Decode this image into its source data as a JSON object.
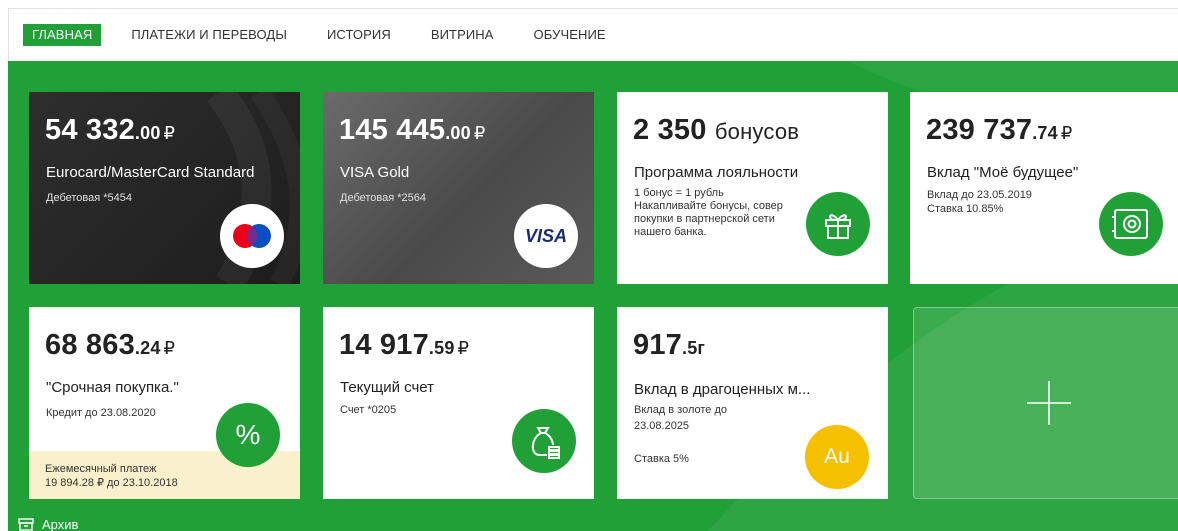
{
  "nav": {
    "items": [
      {
        "label": "ГЛАВНАЯ",
        "active": true
      },
      {
        "label": "ПЛАТЕЖИ И ПЕРЕВОДЫ",
        "active": false
      },
      {
        "label": "ИСТОРИЯ",
        "active": false
      },
      {
        "label": "ВИТРИНА",
        "active": false
      },
      {
        "label": "ОБУЧЕНИЕ",
        "active": false
      }
    ]
  },
  "colors": {
    "brand_green": "#21a038",
    "gold": "#f5c000",
    "payment_band": "#fbf0cc"
  },
  "cards": [
    {
      "amount_int": "54 332",
      "amount_dec": ".00",
      "currency": "₽",
      "name": "Eurocard/MasterCard Standard",
      "sub": "Дебетовая *5454",
      "icon": "mastercard-logo"
    },
    {
      "amount_int": "145 445",
      "amount_dec": ".00",
      "currency": "₽",
      "name": "VISA Gold",
      "sub": "Дебетовая *2564",
      "icon": "visa-logo",
      "logo_text": "VISA"
    },
    {
      "amount_int": "2 350",
      "amount_unit": "бонусов",
      "name": "Программа лояльности",
      "lines": [
        "1 бонус = 1 рубль",
        "Накапливайте бонусы, совер",
        "покупки в партнерской сети",
        "нашего банка."
      ],
      "icon": "gift-icon"
    },
    {
      "amount_int": "239 737",
      "amount_dec": ".74",
      "currency": "₽",
      "name": "Вклад \"Моё будущее\"",
      "lines": [
        "Вклад до 23.05.2019",
        "Ставка 10.85%"
      ],
      "icon": "safe-icon"
    },
    {
      "amount_int": "68 863",
      "amount_dec": ".24",
      "currency": "₽",
      "name": "\"Срочная покупка.\"",
      "sub": "Кредит до 23.08.2020",
      "icon": "percent-icon",
      "icon_text": "%",
      "payment": {
        "label": "Ежемесячный платеж",
        "detail": "19 894.28 ₽ до 23.10.2018"
      }
    },
    {
      "amount_int": "14 917",
      "amount_dec": ".59",
      "currency": "₽",
      "name": "Текущий счет",
      "sub": "Счет *0205",
      "icon": "money-bag-icon"
    },
    {
      "amount_int": "917",
      "amount_dec": ".5",
      "unit": "г",
      "name": "Вклад в драгоценных м...",
      "lines": [
        "Вклад в золоте до",
        "23.08.2025"
      ],
      "rate": "Ставка 5%",
      "icon": "gold-icon",
      "icon_text": "Au"
    }
  ],
  "add_tile": {
    "icon": "plus-icon"
  },
  "archive": {
    "label": "Архив",
    "icon": "archive-icon"
  }
}
